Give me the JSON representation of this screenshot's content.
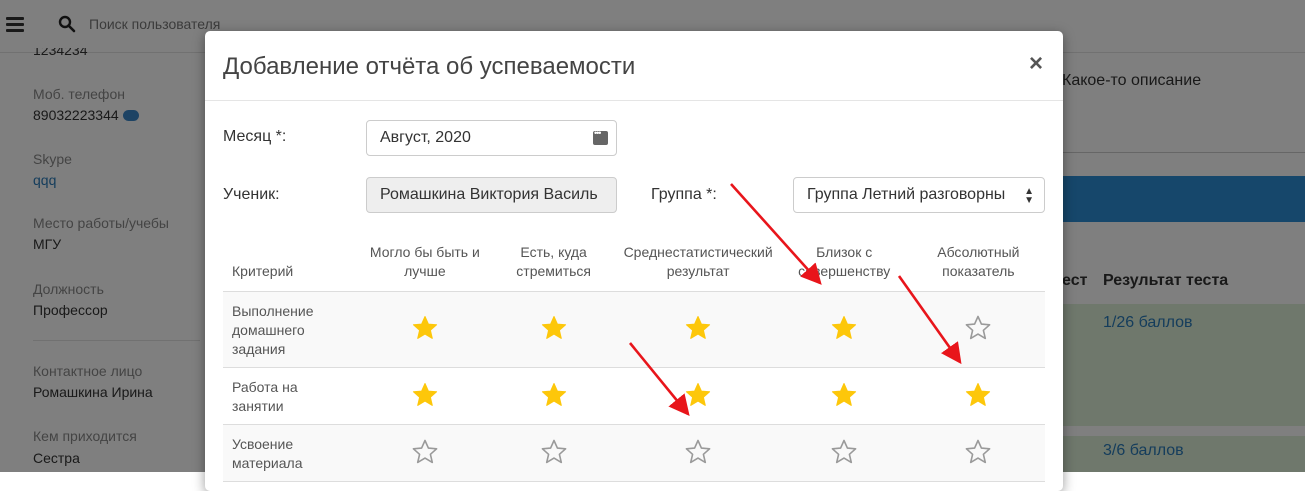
{
  "search": {
    "placeholder": "Поиск пользователя"
  },
  "sidebar": {
    "cut_value": "1234234",
    "phone_label": "Моб. телефон",
    "phone_value": "89032223344",
    "skype_label": "Skype",
    "skype_value": "qqq",
    "work_label": "Место работы/учебы",
    "work_value": "МГУ",
    "position_label": "Должность",
    "position_value": "Профессор",
    "contact_label": "Контактное лицо",
    "contact_value": "Ромашкина Ирина",
    "relation_label": "Кем приходится",
    "relation_value": "Сестра"
  },
  "background_right": {
    "description": "Какое-то описание",
    "col_test_partial": "ест",
    "col_result": "Результат теста",
    "result_1": "1/26 баллов",
    "result_2": "3/6 баллов"
  },
  "modal": {
    "title": "Добавление отчёта об успеваемости",
    "close_symbol": "×",
    "month_label": "Месяц *:",
    "month_value": "Август, 2020",
    "student_label": "Ученик:",
    "student_value": "Ромашкина Виктория Василь",
    "group_label": "Группа *:",
    "group_value": "Группа Летний разговорны",
    "table": {
      "criterion_header": "Критерий",
      "levels": [
        "Могло бы быть и лучше",
        "Есть, куда стремиться",
        "Среднестатистический результат",
        "Близок с совершенству",
        "Абсолютный показатель"
      ],
      "rows": [
        {
          "criterion": "Выполнение домашнего задания",
          "stars": [
            true,
            true,
            true,
            true,
            false
          ]
        },
        {
          "criterion": "Работа на занятии",
          "stars": [
            true,
            true,
            true,
            true,
            true
          ]
        },
        {
          "criterion": "Усвоение материала",
          "stars": [
            false,
            false,
            false,
            false,
            false
          ]
        }
      ]
    }
  },
  "colors": {
    "star_filled": "#fdc70a",
    "star_empty_stroke": "#9a9a9a",
    "arrow": "#e8151b",
    "blue_bar": "#2c8ed6",
    "link": "#2a7ab8",
    "row_green": "#dff0d8"
  },
  "icons": {
    "menu": "hamburger-icon",
    "search": "search-icon",
    "sms": "sms-icon",
    "calendar": "calendar-icon",
    "select": "select-arrows-icon",
    "star_filled": "star-filled-icon",
    "star_empty": "star-empty-icon"
  }
}
